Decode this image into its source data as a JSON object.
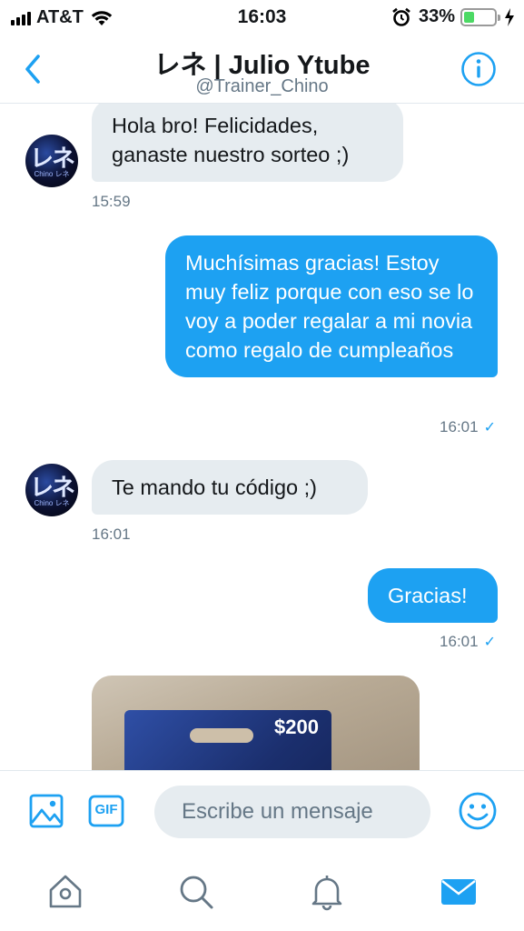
{
  "status_bar": {
    "carrier": "AT&T",
    "time": "16:03",
    "battery_percent_label": "33%",
    "battery_level": 0.33,
    "battery_color": "#4cd964"
  },
  "header": {
    "title": "レネ | Julio Ytube",
    "subtitle": "@Trainer_Chino",
    "back_icon": "chevron-left-icon",
    "info_icon": "info-icon"
  },
  "conversation": {
    "messages": [
      {
        "direction": "in",
        "text": "Hola bro! Felicidades, ganaste nuestro sorteo ;)",
        "timestamp": "15:59"
      },
      {
        "direction": "out",
        "text": "Muchísimas gracias! Estoy muy feliz porque con eso se lo voy a poder regalar a mi novia como regalo de cumpleaños",
        "timestamp": "16:01"
      },
      {
        "direction": "in",
        "text": "Te mando tu código ;)",
        "timestamp": "16:01"
      },
      {
        "direction": "out",
        "text": "Gracias!",
        "timestamp": "16:01"
      }
    ],
    "avatar_text": "レネ",
    "avatar_subtext": "Chino レネ",
    "read_check": "✓",
    "image_message": {
      "card_amount": "$200"
    }
  },
  "composer": {
    "placeholder": "Escribe un mensaje",
    "gif_label": "GIF",
    "icons": [
      "image-icon",
      "gif-icon",
      "emoji-icon"
    ]
  },
  "tabbar": {
    "items": [
      "home-icon",
      "search-icon",
      "notifications-icon",
      "messages-icon"
    ],
    "active": "messages-icon"
  },
  "colors": {
    "accent": "#1da1f2",
    "incoming_bubble": "#e6ecf0",
    "secondary_text": "#657786"
  }
}
